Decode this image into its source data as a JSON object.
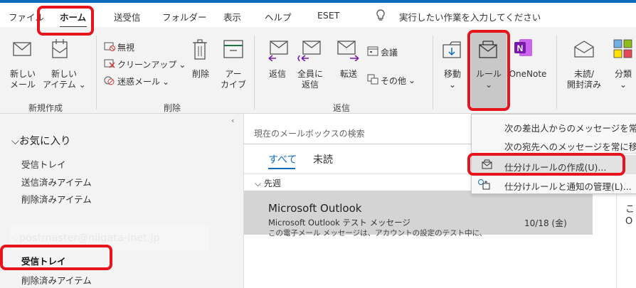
{
  "tabs": {
    "file": "ファイル",
    "home": "ホーム",
    "send_receive": "送受信",
    "folder": "フォルダー",
    "view": "表示",
    "help": "ヘルプ",
    "eset": "ESET",
    "tell_me": "実行したい作業を入力してください"
  },
  "ribbon": {
    "new_group": {
      "new_mail": [
        "新しい",
        "メール"
      ],
      "new_items": [
        "新しい",
        "アイテム"
      ],
      "label": "新規作成"
    },
    "delete_group": {
      "ignore": "無視",
      "cleanup": "クリーンアップ",
      "junk": "迷惑メール",
      "delete": "削除",
      "archive": [
        "アー",
        "カイブ"
      ],
      "label": "削除"
    },
    "respond_group": {
      "reply": "返信",
      "reply_all": [
        "全員に",
        "返信"
      ],
      "forward": "転送",
      "meeting": "会議",
      "more": "その他",
      "label": "返信"
    },
    "move_group": {
      "move": "移動",
      "rules": "ルール",
      "onenote": "OneNote"
    },
    "tags_group": {
      "unread_read": [
        "未読/",
        "開封済み"
      ],
      "categorize": "分類"
    }
  },
  "rules_menu": {
    "items": [
      "次の差出人からのメッセージを常に移",
      "次の宛先へのメッセージを常に移動",
      "仕分けルールの作成(U)...",
      "仕分けルールと通知の管理(L)..."
    ]
  },
  "folders": {
    "favorites_header": "お気に入り",
    "favorites": [
      "受信トレイ",
      "送信済みアイテム",
      "削除済みアイテム"
    ],
    "account": "postmaster@niigata-inet.jp",
    "account_items": [
      "受信トレイ",
      "削除済みアイテム"
    ]
  },
  "message_list": {
    "search_placeholder": "現在のメールボックスの検索",
    "filter_all": "すべて",
    "filter_unread": "未読",
    "group_header": "先週",
    "message": {
      "sender": "Microsoft Outlook",
      "subject": "Microsoft Outlook テスト メッセージ",
      "preview": "この電子メール メッセージは、アカウントの設定のテスト中に、",
      "date": "10/18 (金)"
    }
  },
  "reading_pane": {
    "fragment_1": "こ",
    "fragment_2": "O"
  },
  "colors": {
    "highlight": "#e8141c",
    "accent_blue": "#0f6cbd",
    "selected_row": "#d4d4d4",
    "onenote_purple": "#7719aa"
  }
}
